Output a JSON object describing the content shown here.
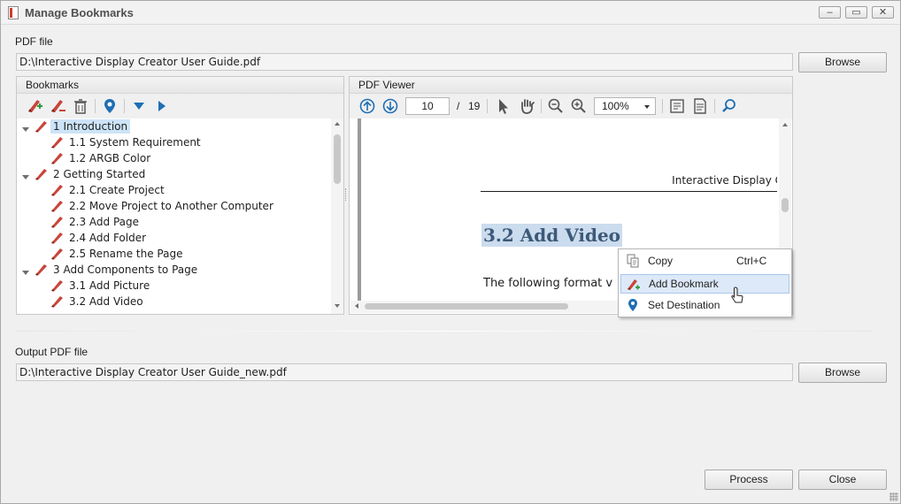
{
  "window": {
    "title": "Manage Bookmarks",
    "controls": {
      "minimize": "–",
      "maximize": "▭",
      "close": "✕"
    }
  },
  "pdf_file": {
    "label": "PDF file",
    "value": "D:\\Interactive Display Creator User Guide.pdf",
    "browse_label": "Browse"
  },
  "bookmarks_panel": {
    "title": "Bookmarks",
    "toolbar_icons": [
      "add-bookmark-icon",
      "remove-bookmark-icon",
      "trash-icon",
      "location-pin-icon",
      "expand-all-icon",
      "collapse-all-icon"
    ],
    "items": [
      {
        "label": "1 Introduction",
        "level": 0,
        "expanded": true,
        "selected": true
      },
      {
        "label": "1.1 System Requirement",
        "level": 1
      },
      {
        "label": "1.2 ARGB Color",
        "level": 1
      },
      {
        "label": "2 Getting Started",
        "level": 0,
        "expanded": true
      },
      {
        "label": "2.1 Create Project",
        "level": 1
      },
      {
        "label": "2.2 Move Project to Another Computer",
        "level": 1
      },
      {
        "label": "2.3 Add Page",
        "level": 1
      },
      {
        "label": "2.4 Add Folder",
        "level": 1
      },
      {
        "label": "2.5 Rename the Page",
        "level": 1
      },
      {
        "label": "3 Add Components to Page",
        "level": 0,
        "expanded": true
      },
      {
        "label": "3.1 Add Picture",
        "level": 1
      },
      {
        "label": "3.2 Add Video",
        "level": 1
      }
    ]
  },
  "pdf_viewer": {
    "title": "PDF Viewer",
    "current_page": "10",
    "page_separator": "/",
    "total_pages": "19",
    "zoom": "100%",
    "document": {
      "header": "Interactive Display Cr",
      "heading": "3.2 Add Video",
      "body": "The following format v"
    }
  },
  "context_menu": {
    "items": [
      {
        "label": "Copy",
        "shortcut": "Ctrl+C",
        "icon": "copy-icon"
      },
      {
        "label": "Add Bookmark",
        "shortcut": "",
        "icon": "add-bookmark-icon",
        "hover": true
      },
      {
        "label": "Set Destination",
        "shortcut": "",
        "icon": "location-pin-icon"
      }
    ]
  },
  "output_pdf_file": {
    "label": "Output PDF file",
    "value": "D:\\Interactive Display Creator User Guide_new.pdf",
    "browse_label": "Browse"
  },
  "footer": {
    "process_label": "Process",
    "close_label": "Close"
  },
  "colors": {
    "selection": "#cde3f7",
    "bookmark_red": "#c8453a",
    "icon_blue": "#1e6fb4",
    "heading_text": "#3d5978",
    "heading_highlight": "#cbdcee"
  }
}
